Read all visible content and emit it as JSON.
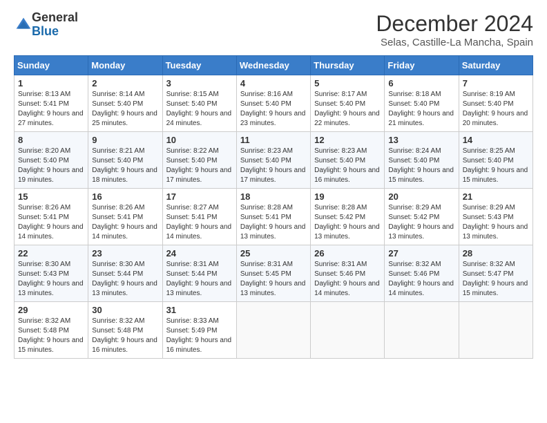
{
  "logo": {
    "general": "General",
    "blue": "Blue"
  },
  "title": "December 2024",
  "location": "Selas, Castille-La Mancha, Spain",
  "weekdays": [
    "Sunday",
    "Monday",
    "Tuesday",
    "Wednesday",
    "Thursday",
    "Friday",
    "Saturday"
  ],
  "weeks": [
    [
      {
        "day": "1",
        "sunrise": "8:13 AM",
        "sunset": "5:41 PM",
        "daylight": "9 hours and 27 minutes."
      },
      {
        "day": "2",
        "sunrise": "8:14 AM",
        "sunset": "5:40 PM",
        "daylight": "9 hours and 25 minutes."
      },
      {
        "day": "3",
        "sunrise": "8:15 AM",
        "sunset": "5:40 PM",
        "daylight": "9 hours and 24 minutes."
      },
      {
        "day": "4",
        "sunrise": "8:16 AM",
        "sunset": "5:40 PM",
        "daylight": "9 hours and 23 minutes."
      },
      {
        "day": "5",
        "sunrise": "8:17 AM",
        "sunset": "5:40 PM",
        "daylight": "9 hours and 22 minutes."
      },
      {
        "day": "6",
        "sunrise": "8:18 AM",
        "sunset": "5:40 PM",
        "daylight": "9 hours and 21 minutes."
      },
      {
        "day": "7",
        "sunrise": "8:19 AM",
        "sunset": "5:40 PM",
        "daylight": "9 hours and 20 minutes."
      }
    ],
    [
      {
        "day": "8",
        "sunrise": "8:20 AM",
        "sunset": "5:40 PM",
        "daylight": "9 hours and 19 minutes."
      },
      {
        "day": "9",
        "sunrise": "8:21 AM",
        "sunset": "5:40 PM",
        "daylight": "9 hours and 18 minutes."
      },
      {
        "day": "10",
        "sunrise": "8:22 AM",
        "sunset": "5:40 PM",
        "daylight": "9 hours and 17 minutes."
      },
      {
        "day": "11",
        "sunrise": "8:23 AM",
        "sunset": "5:40 PM",
        "daylight": "9 hours and 17 minutes."
      },
      {
        "day": "12",
        "sunrise": "8:23 AM",
        "sunset": "5:40 PM",
        "daylight": "9 hours and 16 minutes."
      },
      {
        "day": "13",
        "sunrise": "8:24 AM",
        "sunset": "5:40 PM",
        "daylight": "9 hours and 15 minutes."
      },
      {
        "day": "14",
        "sunrise": "8:25 AM",
        "sunset": "5:40 PM",
        "daylight": "9 hours and 15 minutes."
      }
    ],
    [
      {
        "day": "15",
        "sunrise": "8:26 AM",
        "sunset": "5:41 PM",
        "daylight": "9 hours and 14 minutes."
      },
      {
        "day": "16",
        "sunrise": "8:26 AM",
        "sunset": "5:41 PM",
        "daylight": "9 hours and 14 minutes."
      },
      {
        "day": "17",
        "sunrise": "8:27 AM",
        "sunset": "5:41 PM",
        "daylight": "9 hours and 14 minutes."
      },
      {
        "day": "18",
        "sunrise": "8:28 AM",
        "sunset": "5:41 PM",
        "daylight": "9 hours and 13 minutes."
      },
      {
        "day": "19",
        "sunrise": "8:28 AM",
        "sunset": "5:42 PM",
        "daylight": "9 hours and 13 minutes."
      },
      {
        "day": "20",
        "sunrise": "8:29 AM",
        "sunset": "5:42 PM",
        "daylight": "9 hours and 13 minutes."
      },
      {
        "day": "21",
        "sunrise": "8:29 AM",
        "sunset": "5:43 PM",
        "daylight": "9 hours and 13 minutes."
      }
    ],
    [
      {
        "day": "22",
        "sunrise": "8:30 AM",
        "sunset": "5:43 PM",
        "daylight": "9 hours and 13 minutes."
      },
      {
        "day": "23",
        "sunrise": "8:30 AM",
        "sunset": "5:44 PM",
        "daylight": "9 hours and 13 minutes."
      },
      {
        "day": "24",
        "sunrise": "8:31 AM",
        "sunset": "5:44 PM",
        "daylight": "9 hours and 13 minutes."
      },
      {
        "day": "25",
        "sunrise": "8:31 AM",
        "sunset": "5:45 PM",
        "daylight": "9 hours and 13 minutes."
      },
      {
        "day": "26",
        "sunrise": "8:31 AM",
        "sunset": "5:46 PM",
        "daylight": "9 hours and 14 minutes."
      },
      {
        "day": "27",
        "sunrise": "8:32 AM",
        "sunset": "5:46 PM",
        "daylight": "9 hours and 14 minutes."
      },
      {
        "day": "28",
        "sunrise": "8:32 AM",
        "sunset": "5:47 PM",
        "daylight": "9 hours and 15 minutes."
      }
    ],
    [
      {
        "day": "29",
        "sunrise": "8:32 AM",
        "sunset": "5:48 PM",
        "daylight": "9 hours and 15 minutes."
      },
      {
        "day": "30",
        "sunrise": "8:32 AM",
        "sunset": "5:48 PM",
        "daylight": "9 hours and 16 minutes."
      },
      {
        "day": "31",
        "sunrise": "8:33 AM",
        "sunset": "5:49 PM",
        "daylight": "9 hours and 16 minutes."
      },
      null,
      null,
      null,
      null
    ]
  ]
}
